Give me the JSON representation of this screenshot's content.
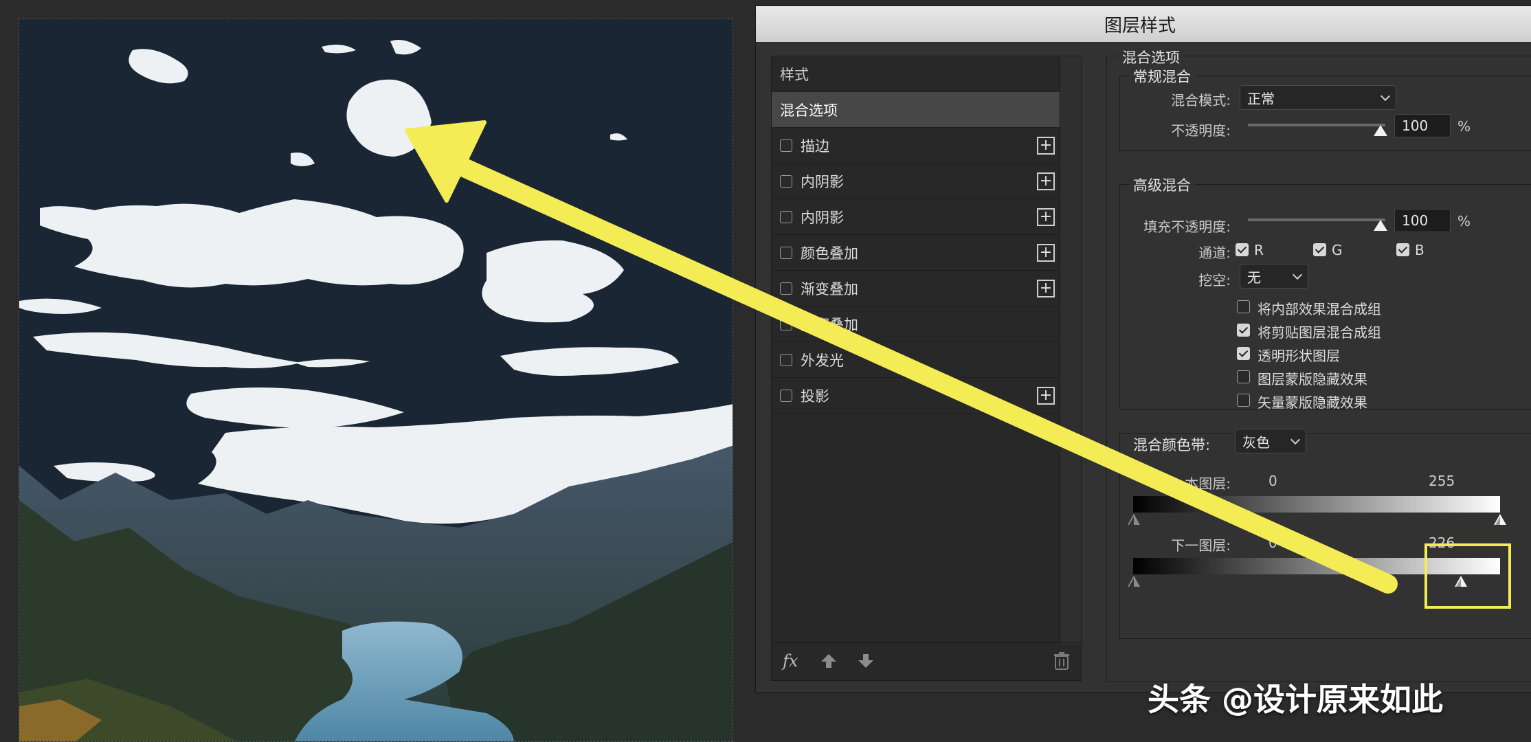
{
  "dialog": {
    "title": "图层样式"
  },
  "styles_panel": {
    "header": "样式",
    "active_item": "混合选项",
    "items": [
      {
        "label": "描边",
        "checked": false,
        "has_add": true
      },
      {
        "label": "内阴影",
        "checked": false,
        "has_add": true
      },
      {
        "label": "内阴影",
        "checked": false,
        "has_add": true
      },
      {
        "label": "颜色叠加",
        "checked": false,
        "has_add": true
      },
      {
        "label": "渐变叠加",
        "checked": false,
        "has_add": true
      },
      {
        "label": "图案叠加",
        "checked": false,
        "has_add": false
      },
      {
        "label": "外发光",
        "checked": false,
        "has_add": false
      },
      {
        "label": "投影",
        "checked": false,
        "has_add": true
      }
    ],
    "bottom": {
      "fx_label": "fx"
    }
  },
  "blending": {
    "section_title": "混合选项",
    "general": {
      "title": "常规混合",
      "mode_label": "混合模式:",
      "mode_value": "正常",
      "opacity_label": "不透明度:",
      "opacity_value": "100",
      "percent": "%"
    },
    "advanced": {
      "title": "高级混合",
      "fill_label": "填充不透明度:",
      "fill_value": "100",
      "percent": "%",
      "channels_label": "通道:",
      "channels": [
        {
          "label": "R",
          "checked": true
        },
        {
          "label": "G",
          "checked": true
        },
        {
          "label": "B",
          "checked": true
        }
      ],
      "knockout_label": "挖空:",
      "knockout_value": "无",
      "options": [
        {
          "label": "将内部效果混合成组",
          "checked": false
        },
        {
          "label": "将剪贴图层混合成组",
          "checked": true
        },
        {
          "label": "透明形状图层",
          "checked": true
        },
        {
          "label": "图层蒙版隐藏效果",
          "checked": false
        },
        {
          "label": "矢量蒙版隐藏效果",
          "checked": false
        }
      ]
    },
    "blend_if": {
      "label": "混合颜色带:",
      "value": "灰色",
      "this_layer": {
        "label": "本图层:",
        "min": "0",
        "max": "255"
      },
      "underlying_layer": {
        "label": "下一图层:",
        "min": "0",
        "max": "226"
      }
    }
  },
  "watermark": "头条 @设计原来如此",
  "colors": {
    "annotation_yellow": "#f4ec54",
    "dialog_bg": "#323232",
    "sky": "#1b2634"
  }
}
